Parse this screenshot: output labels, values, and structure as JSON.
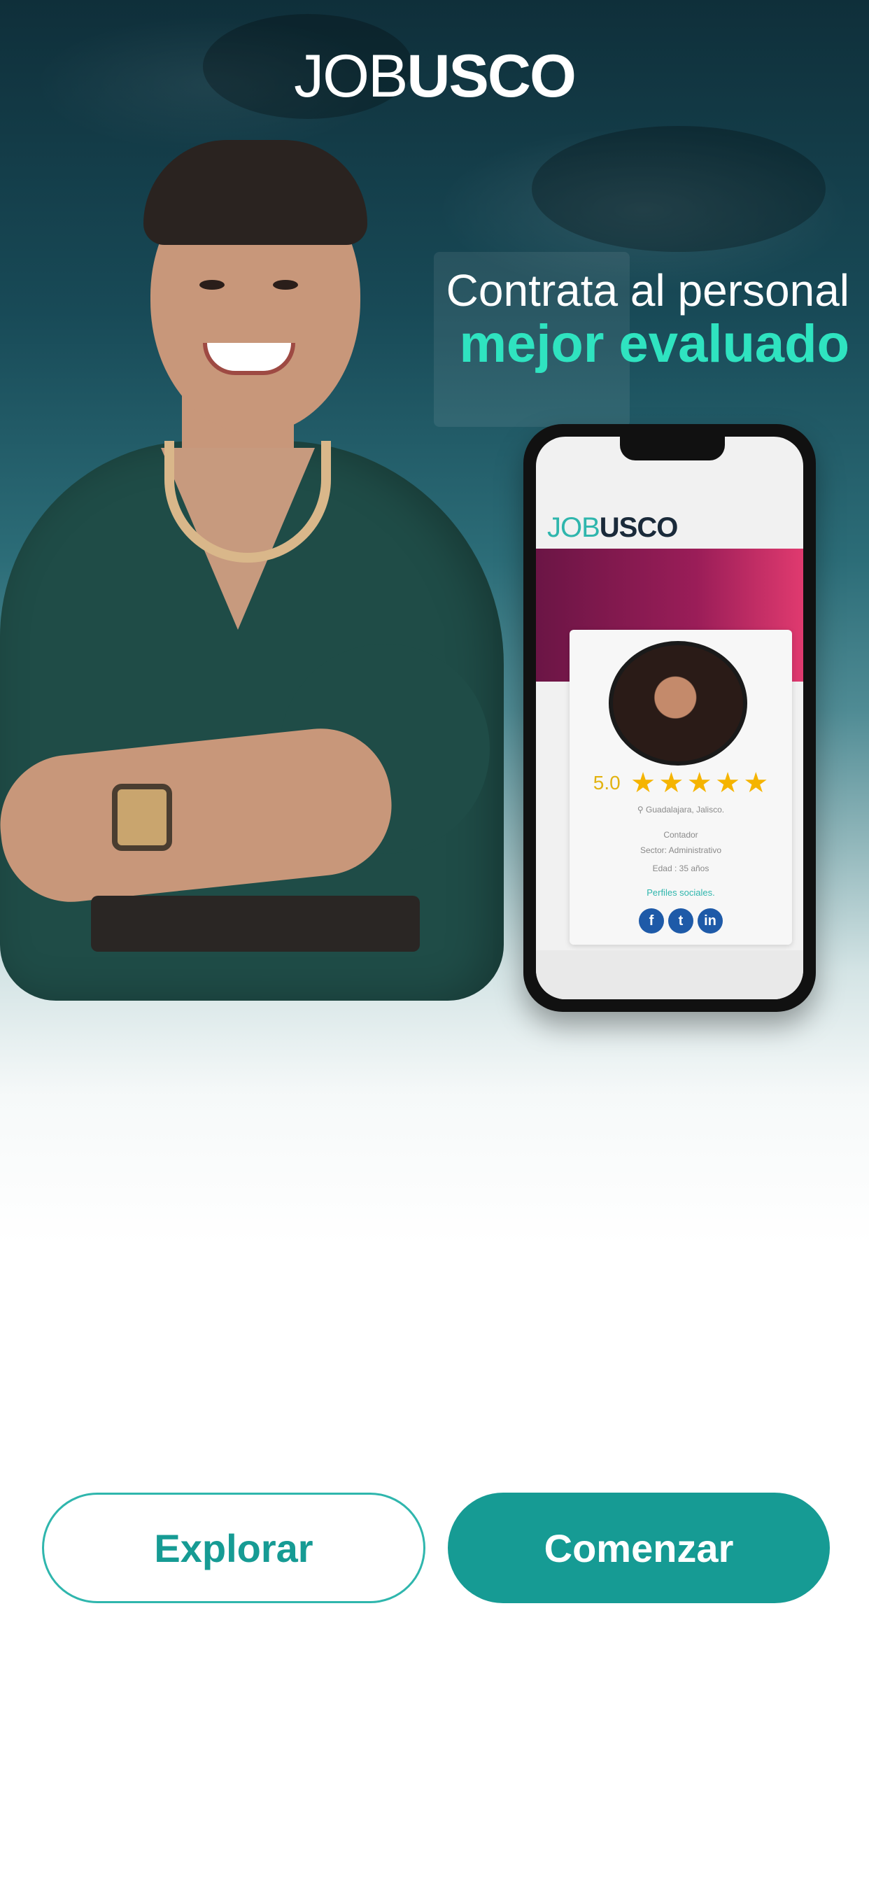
{
  "brand": {
    "logo_light": "JOB",
    "logo_bold": "USCO"
  },
  "hero": {
    "tagline_top": "Contrata al personal",
    "tagline_bottom": "mejor evaluado"
  },
  "phone_mockup": {
    "logo_job": "JOB",
    "logo_usco": "USCO",
    "rating": "5.0",
    "stars": 5,
    "location": "Guadalajara, Jalisco.",
    "role": "Contador",
    "sector": "Sector: Administrativo",
    "age": "Edad : 35 años",
    "social_link": "Perfiles sociales.",
    "social_icons": [
      "facebook-icon",
      "twitter-icon",
      "linkedin-icon"
    ]
  },
  "actions": {
    "explore_label": "Explorar",
    "start_label": "Comenzar"
  },
  "colors": {
    "accent": "#169b94",
    "highlight": "#2fe3c0",
    "star": "#f5b400"
  }
}
